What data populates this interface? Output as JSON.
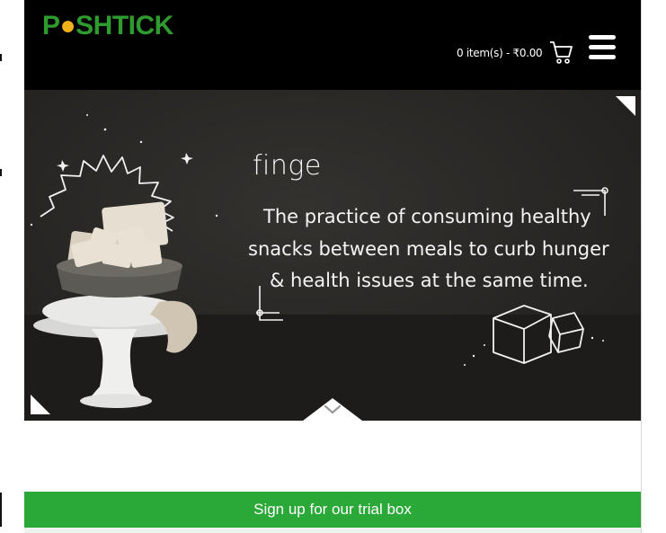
{
  "brand": {
    "name_prefix": "P",
    "name_suffix": "SHTICK",
    "logo_mark": "●",
    "color": "#2e9b2f",
    "mark_color": "#f0b21b"
  },
  "header": {
    "cart_summary": "0 item(s) - ₹0.00",
    "cart_icon": "shopping-cart-icon",
    "menu_icon": "hamburger-menu-icon"
  },
  "hero": {
    "word": "finge",
    "lines": [
      "The practice of consuming healthy",
      "snacks between meals to curb hunger",
      "& health issues at the same time."
    ],
    "scroll_icon": "chevron-down-icon"
  },
  "cta": {
    "label": "Sign up for our trial box",
    "color": "#2aa938"
  }
}
